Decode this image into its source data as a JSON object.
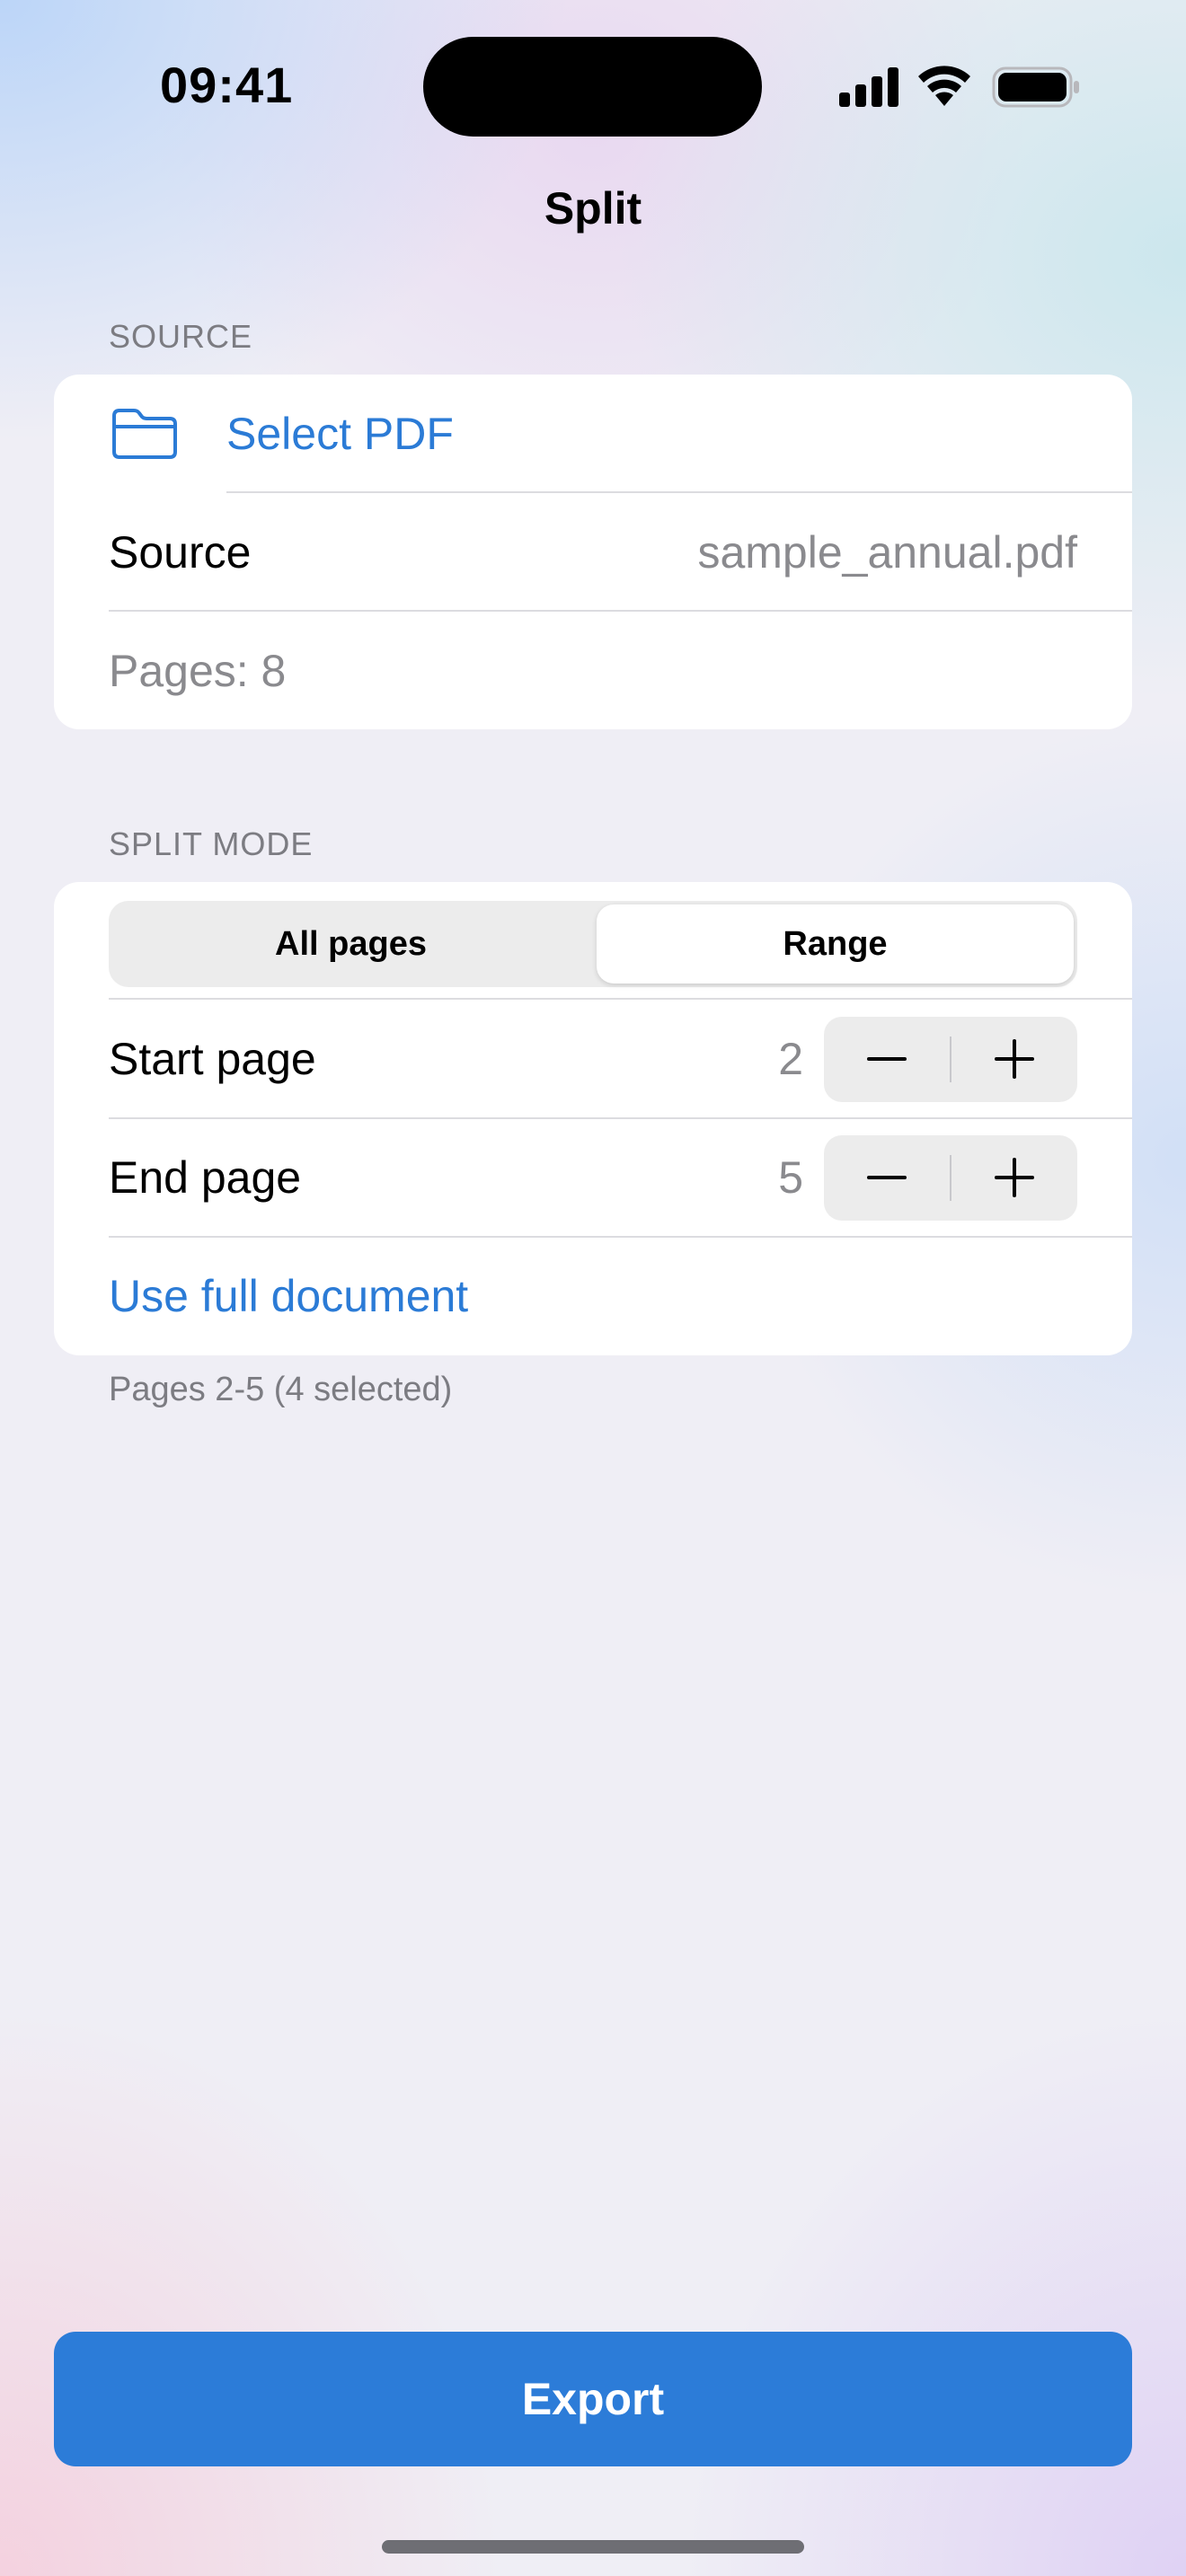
{
  "status_bar": {
    "time": "09:41",
    "icons": [
      "cellular-signal-icon",
      "wifi-icon",
      "battery-icon"
    ]
  },
  "nav": {
    "title": "Split"
  },
  "source_section": {
    "header": "SOURCE",
    "select_pdf_label": "Select PDF",
    "select_pdf_icon": "folder-icon",
    "source_label": "Source",
    "source_value": "sample_annual.pdf",
    "pages_text": "Pages: 8"
  },
  "split_mode_section": {
    "header": "SPLIT MODE",
    "segments": [
      {
        "label": "All pages",
        "selected": false
      },
      {
        "label": "Range",
        "selected": true
      }
    ],
    "start_page": {
      "label": "Start page",
      "value": "2"
    },
    "end_page": {
      "label": "End page",
      "value": "5"
    },
    "use_full_document_label": "Use full document",
    "footer": "Pages 2-5 (4 selected)"
  },
  "export_button_label": "Export",
  "colors": {
    "accent": "#2c7cd8",
    "link": "#2b7bd6",
    "secondary_text": "#8a8a8e"
  }
}
